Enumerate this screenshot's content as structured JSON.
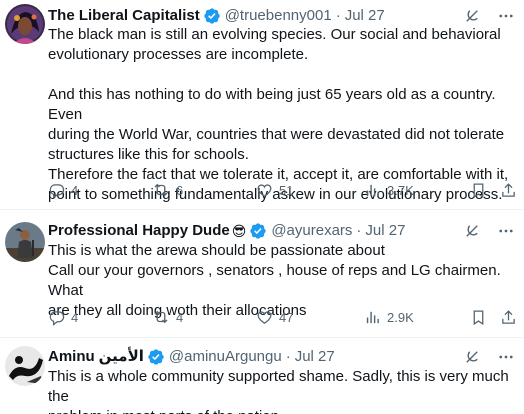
{
  "tweets": [
    {
      "name": "The Liberal Capitalist",
      "handle": "@truebenny001",
      "separator": "·",
      "date": "Jul 27",
      "text": "The black man is still an evolving species. Our social and behavioral\nevolutionary processes are incomplete.\n\nAnd this has nothing to do with being just 65 years old as a country. Even\nduring the World War, countries that were devastated did not tolerate\nstructures like this for schools.\nTherefore the fact that we tolerate it, accept it, are comfortable with it,\npoint to something fundamentally askew in our evolutionary process.",
      "replies": "4",
      "reposts": "6",
      "likes": "51",
      "views": "3.7K",
      "verified": true
    },
    {
      "name": "Professional Happy Dude",
      "emoji": "😎",
      "handle": "@ayurexars",
      "separator": "·",
      "date": "Jul 27",
      "text": "This is what the arewa should be passionate about\nCall our your governors , senators , house of reps and LG chairmen. What\nare they all doing woth their allocations",
      "replies": "4",
      "reposts": "4",
      "likes": "47",
      "views": "2.9K",
      "verified": true
    },
    {
      "name": "Aminu",
      "name_arabic": "الأمين",
      "handle": "@aminuArgungu",
      "separator": "·",
      "date": "Jul 27",
      "text": "This is a whole community supported shame. Sadly, this is very much the\nproblem in most parts of the nation.",
      "verified": true
    }
  ],
  "icons": {
    "grok": "grok-icon",
    "more": "more-icon",
    "reply": "reply-icon",
    "repost": "repost-icon",
    "like": "like-icon",
    "views": "views-icon",
    "bookmark": "bookmark-icon",
    "share": "share-icon"
  },
  "colors": {
    "text": "#0f1419",
    "secondary": "#536471",
    "verified": "#1d9bf0",
    "divider": "#eff3f4"
  }
}
